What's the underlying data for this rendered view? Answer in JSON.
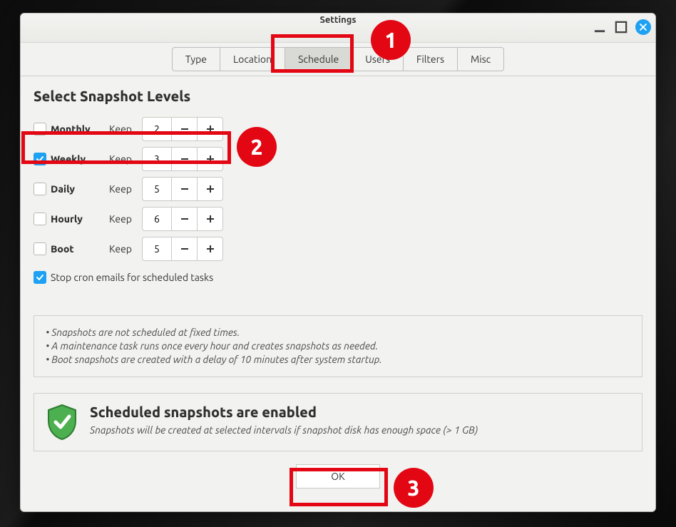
{
  "window": {
    "title": "Settings"
  },
  "tabs": {
    "items": [
      {
        "label": "Type"
      },
      {
        "label": "Location"
      },
      {
        "label": "Schedule"
      },
      {
        "label": "Users"
      },
      {
        "label": "Filters"
      },
      {
        "label": "Misc"
      }
    ],
    "active_index": 2
  },
  "section_title": "Select Snapshot Levels",
  "levels": [
    {
      "name": "Monthly",
      "keep_label": "Keep",
      "value": "2",
      "checked": false
    },
    {
      "name": "Weekly",
      "keep_label": "Keep",
      "value": "3",
      "checked": true
    },
    {
      "name": "Daily",
      "keep_label": "Keep",
      "value": "5",
      "checked": false
    },
    {
      "name": "Hourly",
      "keep_label": "Keep",
      "value": "6",
      "checked": false
    },
    {
      "name": "Boot",
      "keep_label": "Keep",
      "value": "5",
      "checked": false
    }
  ],
  "cron": {
    "checked": true,
    "label": "Stop cron emails for scheduled tasks"
  },
  "notes": {
    "line1": "• Snapshots are not scheduled at fixed times.",
    "line2": "• A maintenance task runs once every hour and creates snapshots as needed.",
    "line3": "• Boot snapshots are created with a delay of 10 minutes after system startup."
  },
  "status": {
    "title": "Scheduled snapshots are enabled",
    "subtitle": "Snapshots will be created at selected intervals if snapshot disk has enough space (> 1 GB)"
  },
  "footer": {
    "ok_label": "OK"
  },
  "annotations": {
    "b1": "1",
    "b2": "2",
    "b3": "3"
  }
}
